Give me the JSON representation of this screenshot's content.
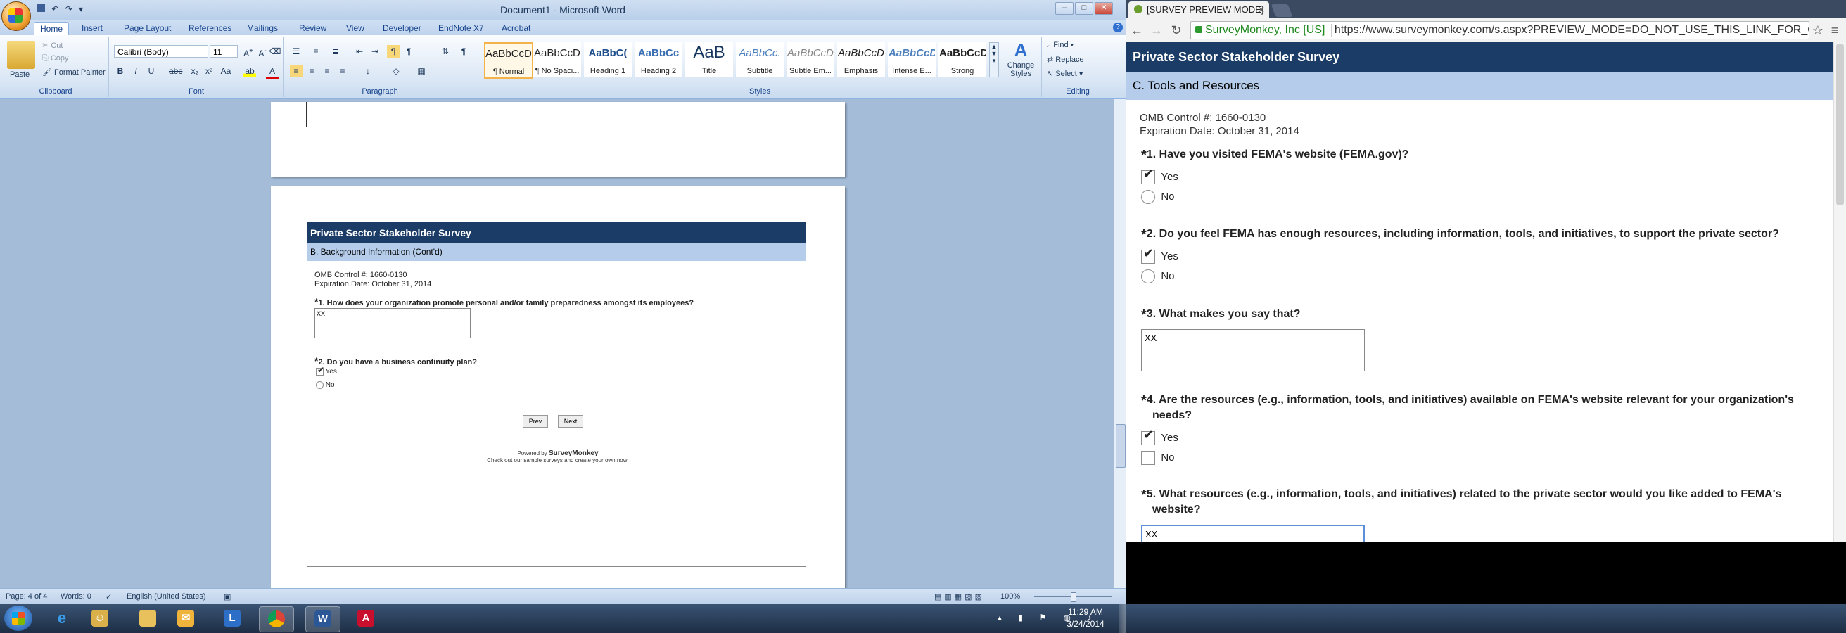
{
  "word": {
    "title": "Document1 - Microsoft Word",
    "tabs": [
      "Home",
      "Insert",
      "Page Layout",
      "References",
      "Mailings",
      "Review",
      "Developer",
      "EndNote X7",
      "Acrobat"
    ],
    "active_tab": "Home",
    "clipboard": {
      "paste": "Paste",
      "cut": "Cut",
      "copy": "Copy",
      "format_painter": "Format Painter",
      "label": "Clipboard"
    },
    "font": {
      "name": "Calibri (Body)",
      "size": "11",
      "label": "Font"
    },
    "paragraph_label": "Paragraph",
    "styles": [
      {
        "preview": "AaBbCcDc",
        "name": "¶ Normal"
      },
      {
        "preview": "AaBbCcDc",
        "name": "¶ No Spaci..."
      },
      {
        "preview": "AaBbC(",
        "name": "Heading 1"
      },
      {
        "preview": "AaBbCc",
        "name": "Heading 2"
      },
      {
        "preview": "AaB",
        "name": "Title"
      },
      {
        "preview": "AaBbCc.",
        "name": "Subtitle"
      },
      {
        "preview": "AaBbCcDc",
        "name": "Subtle Em..."
      },
      {
        "preview": "AaBbCcDc",
        "name": "Emphasis"
      },
      {
        "preview": "AaBbCcDc",
        "name": "Intense E..."
      },
      {
        "preview": "AaBbCcDc",
        "name": "Strong"
      }
    ],
    "styles_label": "Styles",
    "change_styles": "Change Styles",
    "editing": {
      "find": "Find",
      "replace": "Replace",
      "select": "Select",
      "label": "Editing"
    },
    "status": {
      "page": "Page: 4 of 4",
      "words": "Words: 0",
      "language": "English (United States)",
      "zoom": "100%"
    },
    "page_survey": {
      "header": "Private Sector Stakeholder Survey",
      "section": "B. Background Information (Cont'd)",
      "omb": "OMB Control #: 1660-0130",
      "expiration": "Expiration Date: October 31, 2014",
      "q1": "1. How does your organization promote personal and/or family preparedness amongst its employees?",
      "q1_answer": "XX",
      "q2": "2. Do you have a business continuity plan?",
      "yes": "Yes",
      "no": "No",
      "prev": "Prev",
      "next": "Next",
      "powered_by": "Powered by",
      "brand": "SurveyMonkey",
      "checkout_pre": "Check out our",
      "checkout_link": "sample surveys",
      "checkout_post": "and create your own now!"
    }
  },
  "chrome": {
    "tab_title": "[SURVEY PREVIEW MODE]",
    "site_identity": "SurveyMonkey, Inc [US]",
    "url": "https://www.surveymonkey.com/s.aspx?PREVIEW_MODE=DO_NOT_USE_THIS_LINK_FOR_COLLEC",
    "survey": {
      "header": "Private Sector Stakeholder Survey",
      "section": "C. Tools and Resources",
      "omb": "OMB Control #: 1660-0130",
      "expiration": "Expiration Date: October 31, 2014",
      "questions": [
        {
          "text": "1. Have you visited FEMA's website (FEMA.gov)?"
        },
        {
          "text": "2. Do you feel FEMA has enough resources, including information, tools, and initiatives, to support the private sector?"
        },
        {
          "text": "3. What makes you say that?"
        },
        {
          "text": "4. Are the resources (e.g., information, tools, and initiatives) available on FEMA's website relevant for your organization's",
          "text2": "needs?"
        },
        {
          "text": "5. What resources (e.g., information, tools, and initiatives) related to the private sector would you like added to FEMA's",
          "text2": "website?"
        }
      ],
      "yes": "Yes",
      "no": "No",
      "q3_answer": "XX",
      "q5_answer": "XX"
    }
  },
  "taskbar": {
    "time": "11:29 AM",
    "date": "3/24/2014"
  }
}
